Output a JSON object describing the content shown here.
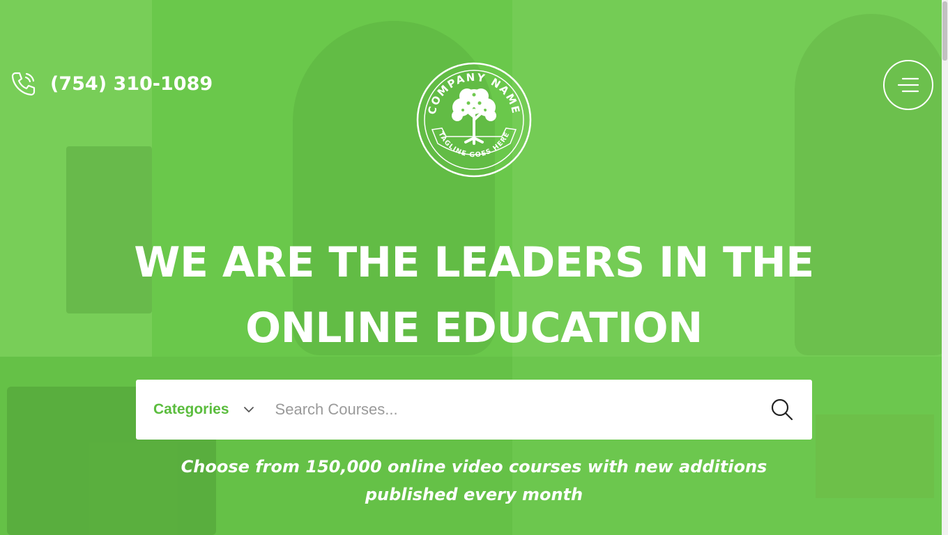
{
  "header": {
    "phone": "(754) 310-1089",
    "logo": {
      "top_text": "COMPANY NAME",
      "bottom_text": "TAGLINE GOES HERE"
    }
  },
  "hero": {
    "headline_line1": "WE ARE THE LEADERS IN THE",
    "headline_line2": "ONLINE EDUCATION",
    "subtitle_line1": "Choose from 150,000 online video courses with new additions",
    "subtitle_line2": "published every month"
  },
  "search": {
    "category_label": "Categories",
    "placeholder": "Search Courses..."
  },
  "colors": {
    "accent": "#5bbd3e",
    "overlay": "#6fc94f",
    "text": "#ffffff"
  },
  "icons": {
    "phone": "phone-icon",
    "menu": "hamburger-icon",
    "search": "search-icon",
    "dropdown": "chevron-down-icon"
  }
}
